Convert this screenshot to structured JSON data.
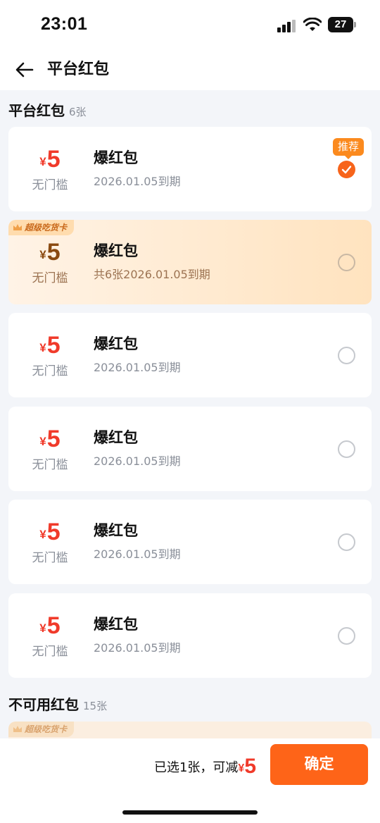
{
  "status_bar": {
    "time": "23:01",
    "battery": "27",
    "icons": [
      "signal-icon",
      "wifi-icon",
      "battery-icon"
    ]
  },
  "nav": {
    "title": "平台红包",
    "back_icon": "arrow-left-icon"
  },
  "platform_section": {
    "title": "平台红包",
    "count": "6张"
  },
  "coupons": [
    {
      "currency": "¥",
      "amount": "5",
      "threshold": "无门槛",
      "title": "爆红包",
      "expiry": "2026.01.05到期",
      "selected": true,
      "tag": "推荐",
      "vip": false
    },
    {
      "currency": "¥",
      "amount": "5",
      "threshold": "无门槛",
      "title": "爆红包",
      "expiry": "共6张2026.01.05到期",
      "selected": false,
      "vip": true,
      "vip_label": "超级吃货卡"
    },
    {
      "currency": "¥",
      "amount": "5",
      "threshold": "无门槛",
      "title": "爆红包",
      "expiry": "2026.01.05到期",
      "selected": false,
      "vip": false
    },
    {
      "currency": "¥",
      "amount": "5",
      "threshold": "无门槛",
      "title": "爆红包",
      "expiry": "2026.01.05到期",
      "selected": false,
      "vip": false
    },
    {
      "currency": "¥",
      "amount": "5",
      "threshold": "无门槛",
      "title": "爆红包",
      "expiry": "2026.01.05到期",
      "selected": false,
      "vip": false
    },
    {
      "currency": "¥",
      "amount": "5",
      "threshold": "无门槛",
      "title": "爆红包",
      "expiry": "2026.01.05到期",
      "selected": false,
      "vip": false
    }
  ],
  "unavailable_section": {
    "title": "不可用红包",
    "count": "15张",
    "first_vip_label": "超级吃货卡"
  },
  "bottom": {
    "summary_prefix": "已选1张，可减",
    "currency": "¥",
    "amount": "5",
    "confirm_label": "确定"
  },
  "colors": {
    "accent": "#fe6418",
    "price_red": "#f03a2a",
    "background": "#f3f5f9"
  }
}
